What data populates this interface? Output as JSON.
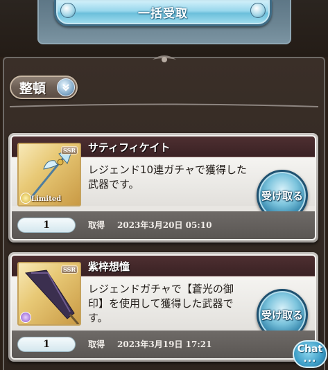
{
  "header": {
    "bulk_receive_label": "一括受取"
  },
  "toolbar": {
    "sort_label": "整頓"
  },
  "items": [
    {
      "name": "サティフィケイト",
      "description": "レジェンド10連ガチャで獲得した武器です。",
      "quantity": "1",
      "acquired_label": "取得",
      "acquired_date": "2023年3月20日 05:10",
      "rarity_badge": "SSR",
      "limited_label": "Limited",
      "receive_label": "受け取る",
      "thumbnail_icon": "halberd-weapon-icon",
      "element_color": "#d6b23b"
    },
    {
      "name": "紫梓想憧",
      "description": "レジェンドガチャで【蒼光の御印】を使用して獲得した武器です。",
      "quantity": "1",
      "acquired_label": "取得",
      "acquired_date": "2023年3月19日 17:21",
      "rarity_badge": "SSR",
      "limited_label": "",
      "receive_label": "受け取る",
      "thumbnail_icon": "umbrella-weapon-icon",
      "element_color": "#8a55c9"
    }
  ],
  "chat": {
    "label": "Chat",
    "dots": "..."
  },
  "colors": {
    "accent_blue": "#6cbfdb",
    "title_bar": "#4e2f31",
    "panel_bg": "#2d241e"
  }
}
